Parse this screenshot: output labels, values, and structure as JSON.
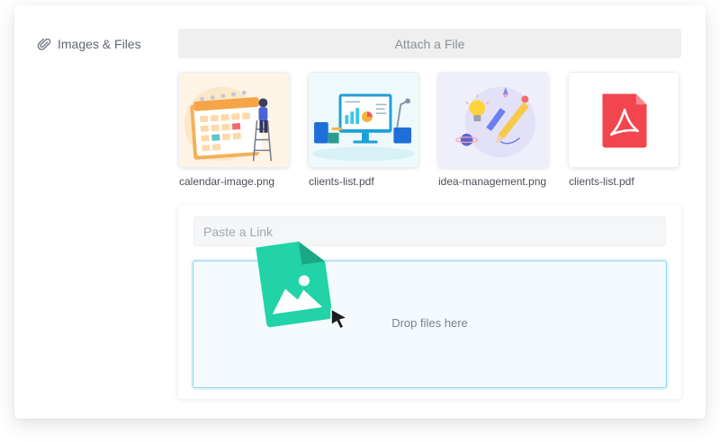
{
  "field": {
    "label": "Images & Files",
    "icon": "paperclip-icon"
  },
  "attach": {
    "label": "Attach a File"
  },
  "files": [
    {
      "name": "calendar-image.png",
      "thumbnail": "calendar-illustration"
    },
    {
      "name": "clients-list.pdf",
      "thumbnail": "dashboard-illustration"
    },
    {
      "name": "idea-management.png",
      "thumbnail": "idea-illustration"
    },
    {
      "name": "clients-list.pdf",
      "thumbnail": "pdf-file-icon"
    }
  ],
  "link": {
    "placeholder": "Paste a Link",
    "value": ""
  },
  "dropzone": {
    "text": "Drop files here"
  },
  "colors": {
    "accent": "#8fd5ec",
    "drag_file": "#21d3a7",
    "pdf_red": "#f2454e",
    "attach_bg": "#efefef"
  }
}
